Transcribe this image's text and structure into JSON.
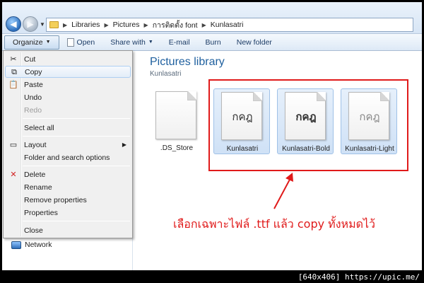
{
  "breadcrumb": [
    "Libraries",
    "Pictures",
    "การติดตั้ง font",
    "Kunlasatri"
  ],
  "toolbar": {
    "organize": "Organize",
    "open": "Open",
    "share": "Share with",
    "email": "E-mail",
    "burn": "Burn",
    "new_folder": "New folder"
  },
  "menu": {
    "cut": "Cut",
    "copy": "Copy",
    "paste": "Paste",
    "undo": "Undo",
    "redo": "Redo",
    "select_all": "Select all",
    "layout": "Layout",
    "folder_options": "Folder and search options",
    "delete": "Delete",
    "rename": "Rename",
    "remove_props": "Remove properties",
    "properties": "Properties",
    "close": "Close"
  },
  "nav": {
    "network": "Network"
  },
  "library": {
    "title": "Pictures library",
    "subtitle": "Kunlasatri"
  },
  "files": [
    {
      "name": ".DS_Store",
      "preview": ""
    },
    {
      "name": "Kunlasatri",
      "preview": "กคฎ"
    },
    {
      "name": "Kunlasatri-Bold",
      "preview": "กคฎ"
    },
    {
      "name": "Kunlasatri-Light",
      "preview": "กคฎ"
    }
  ],
  "annotation": "เลือกเฉพาะไฟล์ .ttf  แล้ว copy ทั้งหมดไว้",
  "watermark": "[640x406] https://upic.me/",
  "colors": {
    "highlight": "#e01a1a",
    "title": "#1e5f9e"
  }
}
